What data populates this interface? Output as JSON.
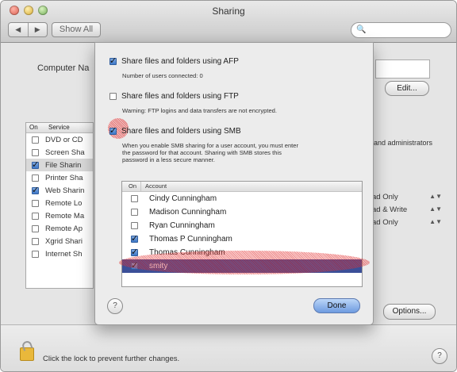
{
  "window": {
    "title": "Sharing",
    "nav": [
      "◀",
      "▶"
    ],
    "show_all": "Show All",
    "search_placeholder": ""
  },
  "main": {
    "computer_name_label": "Computer Na",
    "edit_button": "Edit...",
    "service_list": {
      "headers": [
        "On",
        "Service"
      ],
      "rows": [
        {
          "on": false,
          "label": "DVD or CD"
        },
        {
          "on": false,
          "label": "Screen Sha"
        },
        {
          "on": true,
          "label": "File Sharin"
        },
        {
          "on": false,
          "label": "Printer Sha"
        },
        {
          "on": true,
          "label": "Web Sharin"
        },
        {
          "on": false,
          "label": "Remote Lo"
        },
        {
          "on": false,
          "label": "Remote Ma"
        },
        {
          "on": false,
          "label": "Remote Ap"
        },
        {
          "on": false,
          "label": "Xgrid Shari"
        },
        {
          "on": false,
          "label": "Internet Sh"
        }
      ]
    },
    "admins_text": "and administrators",
    "permissions": [
      "ad Only",
      "ad & Write",
      "ad Only"
    ],
    "options_button": "Options...",
    "lock_text": "Click the lock to prevent further changes.",
    "help": "?"
  },
  "sheet": {
    "afp": {
      "label": "Share files and folders using AFP",
      "checked": true,
      "desc": "Number of users connected: 0"
    },
    "ftp": {
      "label": "Share files and folders using FTP",
      "checked": false,
      "desc": "Warning: FTP logins and data transfers are not encrypted."
    },
    "smb": {
      "label": "Share files and folders using SMB",
      "checked": true,
      "desc1": "When you enable SMB sharing for a user account, you must enter",
      "desc2": "the password for that account. Sharing with SMB stores this",
      "desc3": "password in a less secure manner."
    },
    "accounts": {
      "headers": [
        "On",
        "Account"
      ],
      "rows": [
        {
          "on": false,
          "name": "Cindy Cunningham"
        },
        {
          "on": false,
          "name": "Madison Cunningham"
        },
        {
          "on": false,
          "name": "Ryan Cunningham"
        },
        {
          "on": true,
          "name": "Thomas P Cunningham"
        },
        {
          "on": true,
          "name": "Thomas Cunningham"
        },
        {
          "on": true,
          "name": "smity",
          "selected": true
        }
      ]
    },
    "done_button": "Done",
    "help": "?"
  }
}
